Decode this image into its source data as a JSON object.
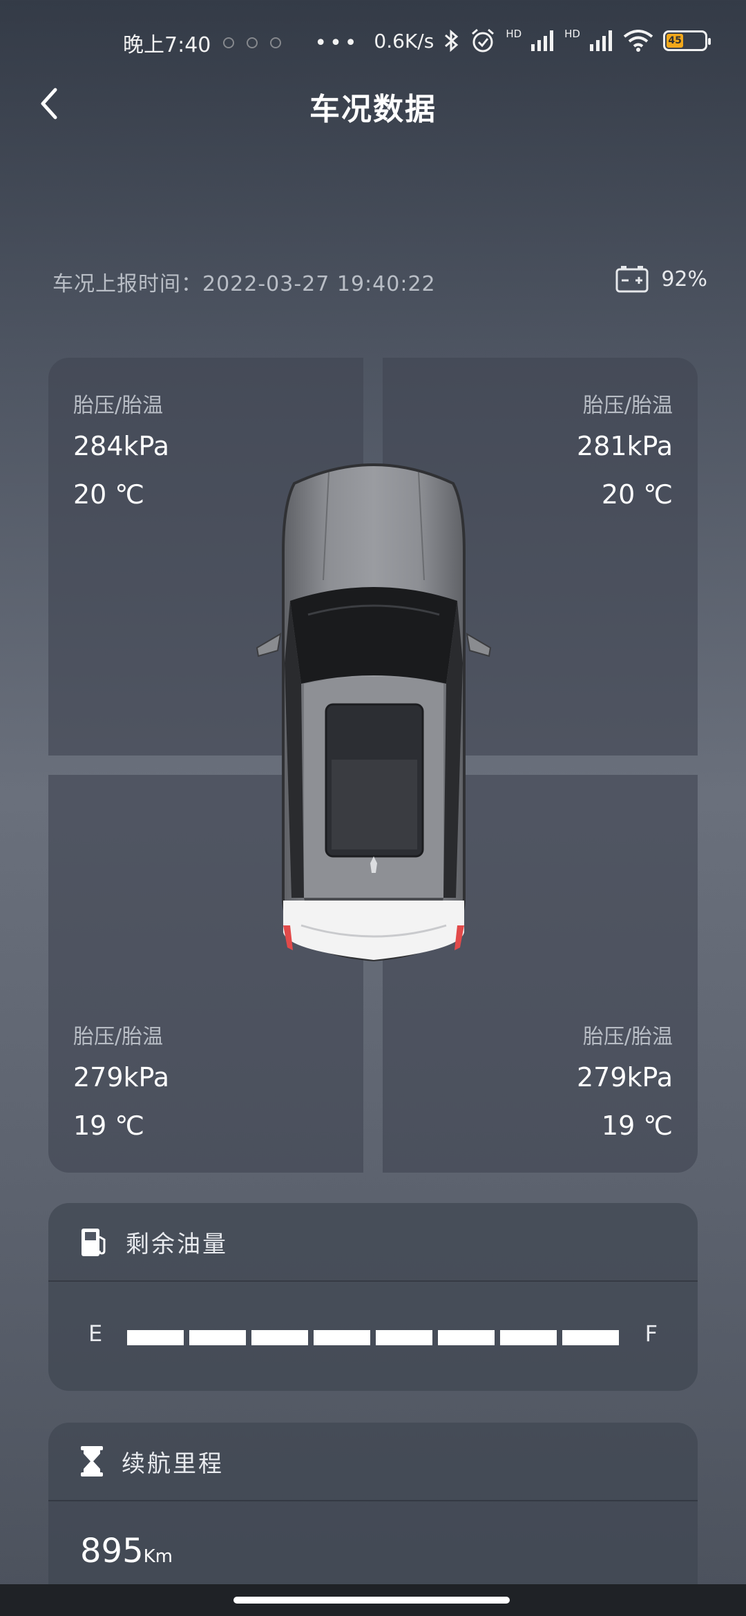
{
  "status_bar": {
    "time": "晚上7:40",
    "net_speed": "0.6K/s",
    "signal_1": "HD",
    "signal_2": "HD",
    "battery_level": "45"
  },
  "nav": {
    "title": "车况数据"
  },
  "report": {
    "label": "车况上报时间：",
    "time": "2022-03-27 19:40:22"
  },
  "car_battery": {
    "percent": "92%"
  },
  "tires": [
    {
      "label": "胎压/胎温",
      "pressure": "284kPa",
      "temp": "20 ℃"
    },
    {
      "label": "胎压/胎温",
      "pressure": "281kPa",
      "temp": "20 ℃"
    },
    {
      "label": "胎压/胎温",
      "pressure": "279kPa",
      "temp": "19 ℃"
    },
    {
      "label": "胎压/胎温",
      "pressure": "279kPa",
      "temp": "19 ℃"
    }
  ],
  "fuel": {
    "title": "剩余油量",
    "empty": "E",
    "full": "F",
    "segments_total": 8,
    "segments_filled": 8
  },
  "range": {
    "title": "续航里程",
    "value": "895",
    "unit": "Km"
  },
  "colors": {
    "accent_battery": "#f2a81b",
    "card_bg": "#404652"
  }
}
